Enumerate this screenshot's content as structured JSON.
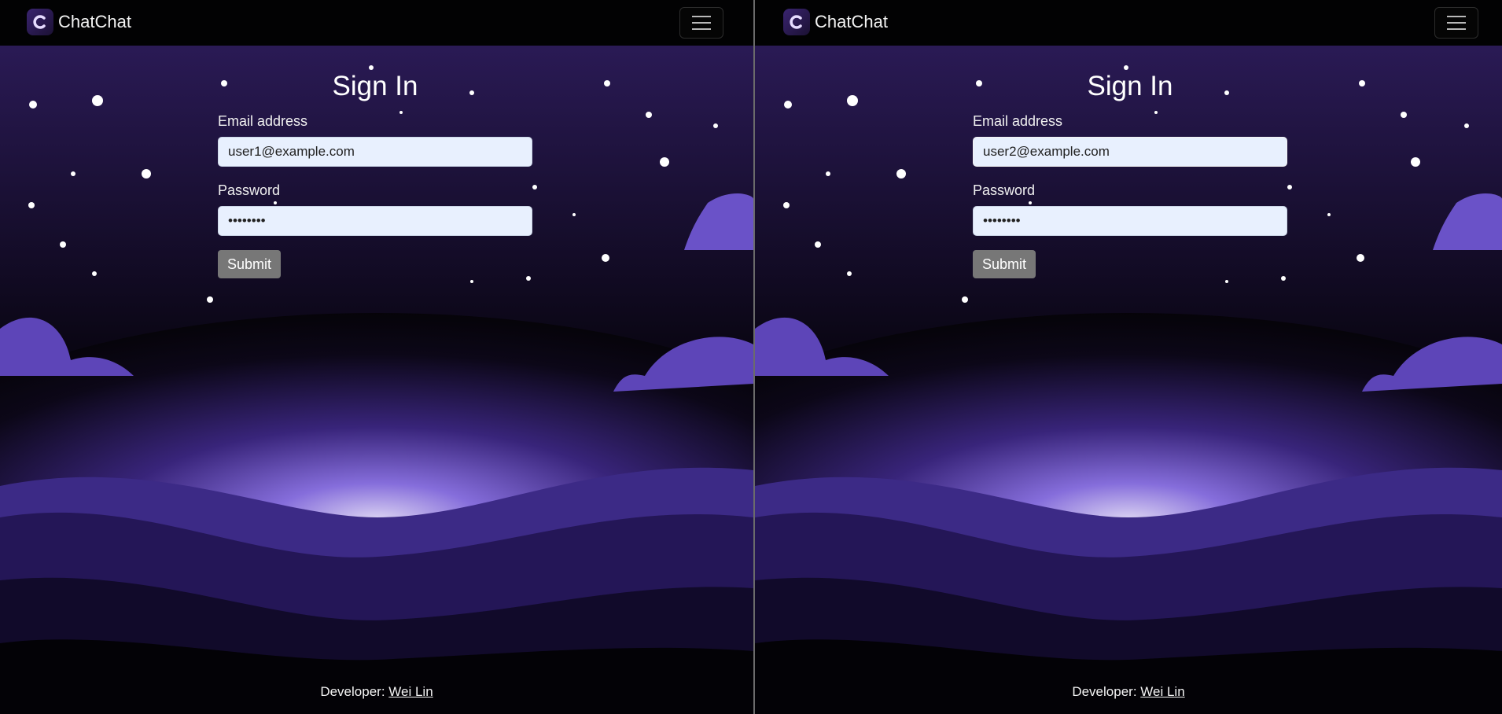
{
  "left": {
    "brand": "ChatChat",
    "title": "Sign In",
    "email_label": "Email address",
    "email_value": "user1@example.com",
    "password_label": "Password",
    "password_value": "••••••••",
    "submit_label": "Submit",
    "footer_prefix": "Developer: ",
    "footer_link": "Wei Lin"
  },
  "right": {
    "brand": "ChatChat",
    "title": "Sign In",
    "email_label": "Email address",
    "email_value": "user2@example.com",
    "password_label": "Password",
    "password_value": "••••••••",
    "submit_label": "Submit",
    "footer_prefix": "Developer: ",
    "footer_link": "Wei Lin"
  },
  "icons": {
    "logo": "chatchat-logo-icon",
    "menu": "hamburger-menu-icon"
  },
  "colors": {
    "accent": "#6a4fd0",
    "background": "#0b0615",
    "input_bg": "#e8f0fe",
    "button": "#777777"
  }
}
